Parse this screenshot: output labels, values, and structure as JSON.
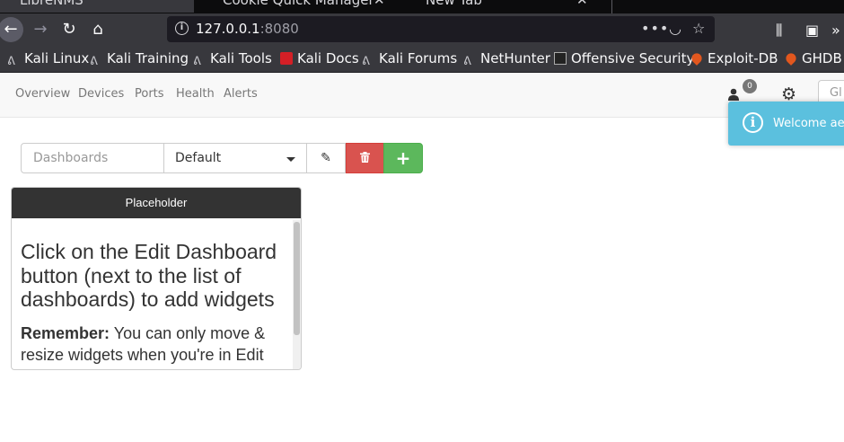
{
  "browser": {
    "tabs": [
      {
        "title": "LibreNMS",
        "close": "✕"
      },
      {
        "title": "Cookie Quick Manager",
        "close": "✕"
      },
      {
        "title": "New Tab",
        "close": "✕"
      }
    ],
    "url_host": "127.0.0.1",
    "url_port": ":8080",
    "bookmarks": [
      {
        "label": "Kali Linux",
        "icon": "kali-dragon-icon"
      },
      {
        "label": "Kali Training",
        "icon": "kali-dragon-icon"
      },
      {
        "label": "Kali Tools",
        "icon": "kali-dragon-icon"
      },
      {
        "label": "Kali Docs",
        "icon": "kali-docs-icon"
      },
      {
        "label": "Kali Forums",
        "icon": "kali-dragon-icon"
      },
      {
        "label": "NetHunter",
        "icon": "nethunter-icon"
      },
      {
        "label": "Offensive Security",
        "icon": "offsec-icon"
      },
      {
        "label": "Exploit-DB",
        "icon": "exploit-db-icon"
      },
      {
        "label": "GHDB",
        "icon": "ghdb-icon"
      }
    ]
  },
  "app": {
    "nav": [
      "Overview",
      "Devices",
      "Ports",
      "Health",
      "Alerts"
    ],
    "notification_count": "0",
    "search_placeholder": "Gl"
  },
  "toast": {
    "text": "Welcome aeo"
  },
  "dashboard": {
    "label": "Dashboards",
    "selected": "Default"
  },
  "widget": {
    "title": "Placeholder",
    "heading": "Click on the Edit Dashboard button (next to the list of dashboards) to add widgets",
    "remember_label": "Remember:",
    "remember_text": " You can only move & resize widgets when you're in Edit mode."
  },
  "colors": {
    "danger": "#d9534f",
    "success": "#5cb85c",
    "info": "#5bc0de",
    "widget_header": "#333333"
  }
}
